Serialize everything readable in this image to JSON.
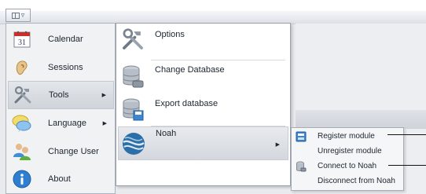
{
  "app_menu_button": {
    "icon": "application-menu-icon",
    "arrow": "chevron-down-icon"
  },
  "main_menu": {
    "items": [
      {
        "label": "Calendar",
        "icon": "calendar-icon",
        "calendar_number": "31",
        "has_submenu": false
      },
      {
        "label": "Sessions",
        "icon": "sessions-ear-icon",
        "has_submenu": false
      },
      {
        "label": "Tools",
        "icon": "tools-icon",
        "has_submenu": true,
        "selected": true
      },
      {
        "label": "Language",
        "icon": "speech-bubble-icon",
        "has_submenu": true
      },
      {
        "label": "Change User",
        "icon": "change-user-icon",
        "has_submenu": false
      },
      {
        "label": "About",
        "icon": "info-icon",
        "has_submenu": false
      }
    ]
  },
  "tools_menu": {
    "items": [
      {
        "label": "Options",
        "icon": "tools-icon",
        "has_submenu": false
      },
      {
        "label": "Change Database",
        "icon": "database-icon",
        "has_submenu": false
      },
      {
        "label": "Export database",
        "icon": "database-export-icon",
        "has_submenu": false
      },
      {
        "label": "Noah",
        "icon": "noah-globe-icon",
        "has_submenu": true,
        "selected": true
      }
    ]
  },
  "noah_menu": {
    "items": [
      {
        "label": "Register module",
        "icon": "register-module-icon"
      },
      {
        "label": "Unregister module",
        "icon": ""
      },
      {
        "label": "Connect to Noah",
        "icon": "connect-database-icon"
      },
      {
        "label": "Disconnect from Noah",
        "icon": ""
      }
    ]
  },
  "colors": {
    "accent": "#2f7fd1",
    "menu_bg": "#f1f2f4",
    "selection": "#d4d8de",
    "text": "#1d2530"
  }
}
